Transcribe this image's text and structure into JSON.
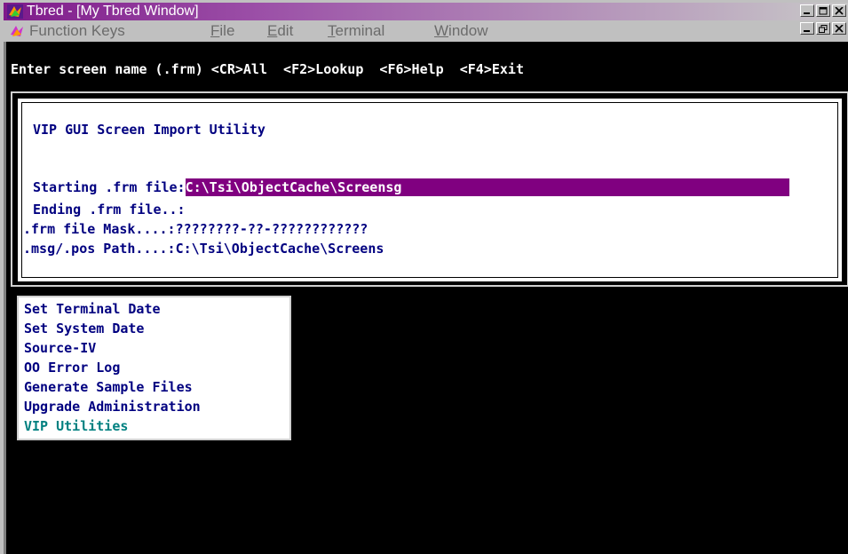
{
  "window": {
    "title": "Tbred - [My Tbred Window]",
    "controls": [
      "minimize-icon",
      "maximize-icon",
      "close-icon"
    ],
    "inner_controls": [
      "minimize-icon",
      "restore-icon",
      "close-icon"
    ]
  },
  "menubar": {
    "items": [
      {
        "label": "Function Keys",
        "ul": ""
      },
      {
        "label": "ile",
        "ul": "F"
      },
      {
        "label": "dit",
        "ul": "E"
      },
      {
        "label": "erminal",
        "ul": "T"
      },
      {
        "label": "indow",
        "ul": "W"
      }
    ]
  },
  "command_line": "Enter screen name (.frm) <CR>All  <F2>Lookup  <F6>Help  <F4>Exit",
  "utility": {
    "title": "VIP GUI Screen Import Utility",
    "fields": [
      {
        "label": "Starting .frm file:",
        "value": "C:\\Tsi\\ObjectCache\\Screensg"
      },
      {
        "label": "Ending .frm file..:",
        "value": ""
      },
      {
        "label": ".frm file Mask....:",
        "value": "????????-??-????????????"
      },
      {
        "label": ".msg/.pos Path....:",
        "value": "C:\\Tsi\\ObjectCache\\Screens"
      }
    ]
  },
  "menu_list": {
    "items": [
      "Set Terminal Date",
      "Set System Date",
      "Source-IV",
      "OO Error Log",
      "Generate Sample Files",
      "Upgrade Administration",
      "VIP Utilities"
    ],
    "selected_index": 6
  },
  "colors": {
    "title_gradient_start": "#7f1a8a",
    "highlight": "#800080",
    "text_blue": "#000080",
    "selected_teal": "#008080"
  }
}
